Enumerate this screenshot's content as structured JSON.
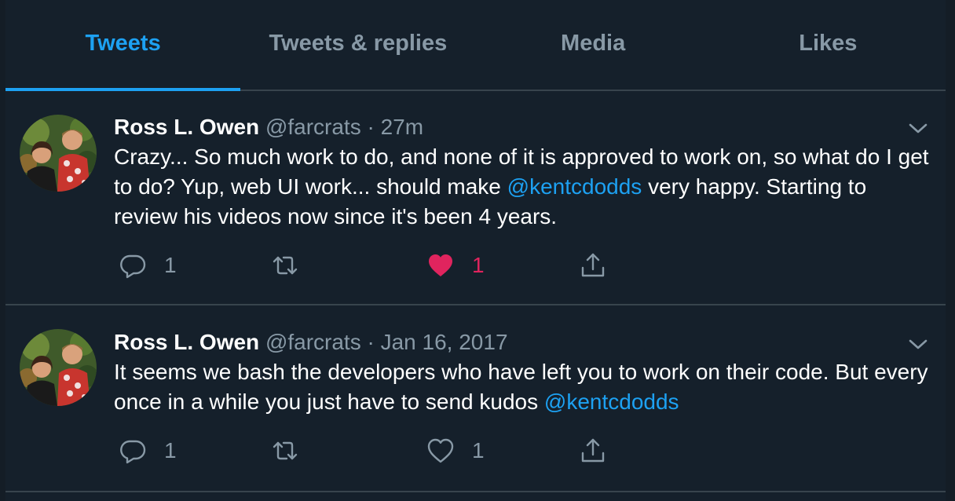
{
  "tabs": [
    {
      "label": "Tweets",
      "active": true
    },
    {
      "label": "Tweets & replies",
      "active": false
    },
    {
      "label": "Media",
      "active": false
    },
    {
      "label": "Likes",
      "active": false
    }
  ],
  "tweets": [
    {
      "name": "Ross L. Owen",
      "handle": "@farcrats",
      "separator": "·",
      "time": "27m",
      "text_before": "Crazy... So much work to do, and none of it is approved to work on, so what do I get to do? Yup, web UI work... should make ",
      "mention": "@kentcdodds",
      "text_after": " very happy. Starting to review his videos now since it's been 4 years.",
      "reply_count": "1",
      "retweet_count": "",
      "like_count": "1",
      "liked": true
    },
    {
      "name": "Ross L. Owen",
      "handle": "@farcrats",
      "separator": "·",
      "time": "Jan 16, 2017",
      "text_before": "It seems we bash the developers who have left you to work on their code. But every once in a while you just have to send kudos ",
      "mention": "@kentcdodds",
      "text_after": "",
      "reply_count": "1",
      "retweet_count": "",
      "like_count": "1",
      "liked": false
    }
  ],
  "colors": {
    "background": "#15202b",
    "accent": "#1da1f2",
    "muted": "#8899a6",
    "like": "#e0245e",
    "border": "#38444d"
  },
  "icons": [
    "reply-icon",
    "retweet-icon",
    "heart-icon",
    "share-icon",
    "chevron-down-icon"
  ]
}
